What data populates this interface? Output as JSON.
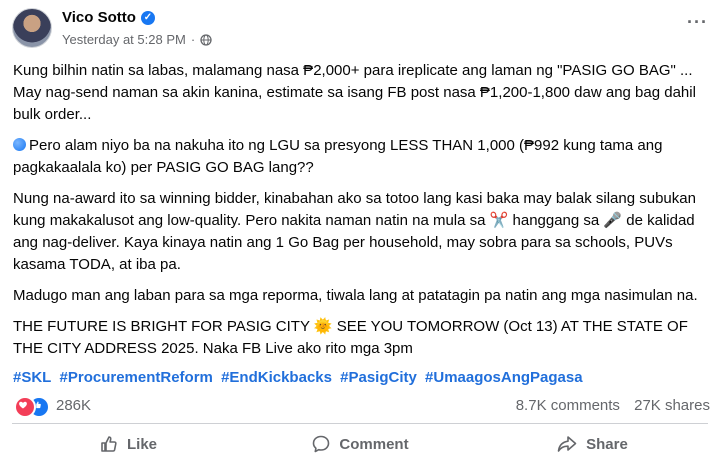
{
  "post": {
    "author": "Vico Sotto",
    "timestamp": "Yesterday at 5:28 PM",
    "paragraphs": [
      "Kung bilhin natin sa labas, malamang nasa ₱2,000+ para ireplicate ang laman ng \"PASIG GO BAG\" ... May nag-send naman sa akin kanina, estimate sa isang FB post nasa ₱1,200-1,800 daw ang bag dahil bulk order...",
      "Pero alam niyo ba na nakuha ito ng LGU sa presyong LESS THAN 1,000 (₱992 kung tama ang pagkakaalala ko) per PASIG GO BAG lang??",
      "Nung na-award ito sa winning bidder, kinabahan ako sa totoo lang kasi baka may balak silang subukan kung makakalusot ang low-quality. Pero nakita naman natin na mula sa ✂️ hanggang sa 🎤 de kalidad ang nag-deliver. Kaya kinaya natin ang 1 Go Bag per household, may sobra para sa schools, PUVs kasama TODA, at iba pa.",
      "Madugo man ang laban para sa mga reporma, tiwala lang at patatagin pa natin ang mga nasimulan na.",
      "THE FUTURE IS BRIGHT FOR PASIG CITY 🌞 SEE YOU TOMORROW (Oct 13) AT THE STATE OF THE CITY ADDRESS 2025. Naka FB Live ako rito mga 3pm"
    ],
    "hashtags": [
      "#SKL",
      "#ProcurementReform",
      "#EndKickbacks",
      "#PasigCity",
      "#UmaagosAngPagasa"
    ]
  },
  "stats": {
    "reactions": "286K",
    "comments": "8.7K comments",
    "shares": "27K shares"
  },
  "actions": {
    "like": "Like",
    "comment": "Comment",
    "share": "Share"
  },
  "colors": {
    "brand_blue": "#1877f2",
    "hashtag": "#216fdb",
    "secondary_text": "#65676b"
  }
}
